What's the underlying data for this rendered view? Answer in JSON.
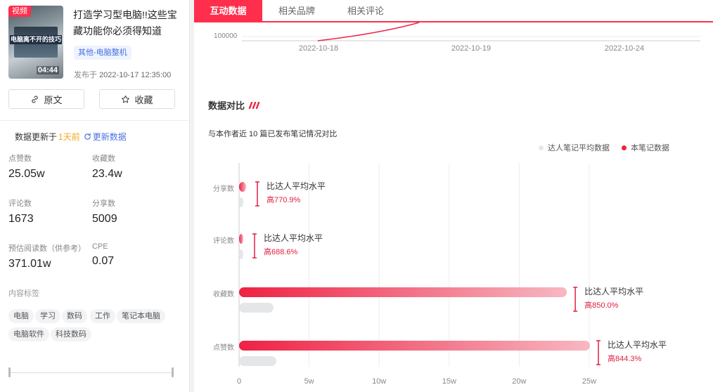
{
  "left": {
    "video_badge": "视频",
    "thumb_caption": "电脑离不开的技巧",
    "duration": "04:44",
    "title": "打造学习型电脑!!这些宝藏功能你必须得知道",
    "category": "其他-电脑整机",
    "publish_label": "发布于",
    "publish_time": "2022-10-17 12:35:00",
    "btn_original": "原文",
    "btn_fav": "收藏",
    "update_prefix": "数据更新于",
    "update_ago": "1天前",
    "refresh_label": "更新数据",
    "stats": [
      {
        "label": "点赞数",
        "value": "25.05w"
      },
      {
        "label": "收藏数",
        "value": "23.4w"
      },
      {
        "label": "评论数",
        "value": "1673"
      },
      {
        "label": "分享数",
        "value": "5009"
      },
      {
        "label": "预估阅读数（供参考）",
        "value": "371.01w"
      },
      {
        "label": "CPE",
        "value": "0.07"
      }
    ],
    "tags_label": "内容标签",
    "tags": [
      "电脑",
      "学习",
      "数码",
      "工作",
      "笔记本电脑",
      "电脑软件",
      "科技数码"
    ]
  },
  "tabs": [
    "互动数据",
    "相关品牌",
    "相关评论"
  ],
  "trend": {
    "y_label": "100000",
    "x_labels": [
      "2022-10-18",
      "2022-10-19",
      "2022-10-24"
    ]
  },
  "compare": {
    "title": "数据对比",
    "subtitle": "与本作者近 10 篇已发布笔记情况对比",
    "legend_avg": "达人笔记平均数据",
    "legend_note": "本笔记数据",
    "color_note": "#ee2244",
    "color_avg": "#e4e6e8"
  },
  "chart_data": {
    "type": "bar",
    "orientation": "horizontal",
    "categories": [
      "分享数",
      "评论数",
      "收藏数",
      "点赞数"
    ],
    "series": [
      {
        "name": "本笔记数据",
        "values": [
          5009,
          1673,
          234000,
          250500
        ]
      },
      {
        "name": "达人笔记平均数据",
        "values": [
          575,
          212,
          24600,
          26600
        ]
      }
    ],
    "xlim": [
      0,
      250000
    ],
    "x_ticks": [
      "0",
      "5w",
      "10w",
      "15w",
      "20w",
      "25w"
    ],
    "x_tick_values": [
      0,
      50000,
      100000,
      150000,
      200000,
      250000
    ],
    "annotations": [
      {
        "label": "比达人平均水平",
        "value": "高770.9%"
      },
      {
        "label": "比达人平均水平",
        "value": "高688.6%"
      },
      {
        "label": "比达人平均水平",
        "value": "高850.0%"
      },
      {
        "label": "比达人平均水平",
        "value": "高844.3%"
      }
    ],
    "grid": true
  }
}
